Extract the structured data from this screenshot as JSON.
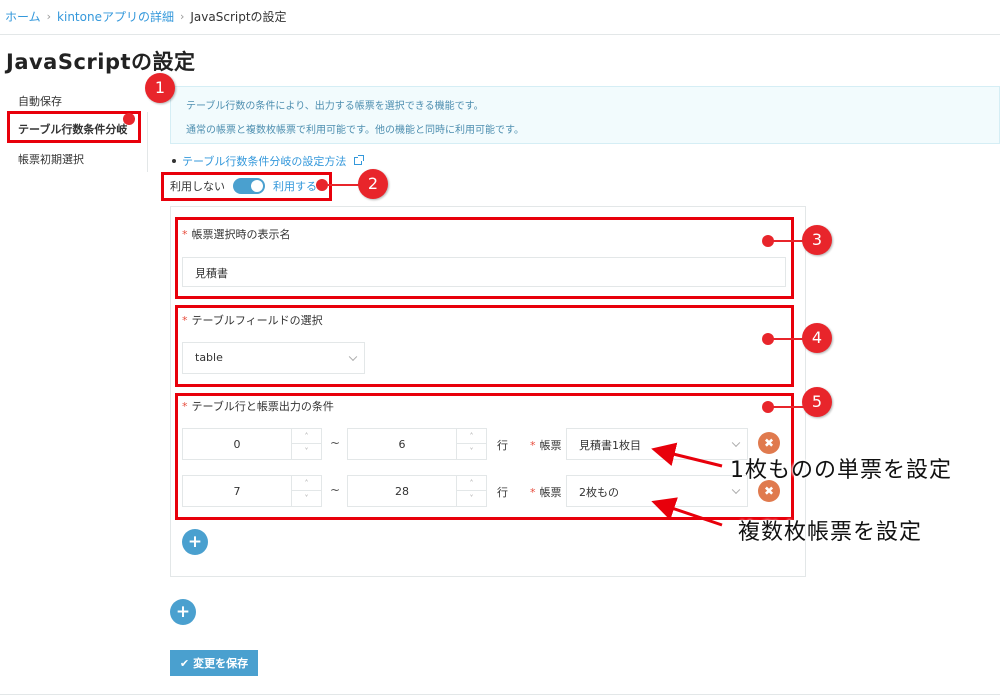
{
  "breadcrumb": {
    "home": "ホーム",
    "app": "kintoneアプリの詳細",
    "current": "JavaScriptの設定"
  },
  "page_title": "JavaScriptの設定",
  "side_nav": {
    "items": [
      {
        "label": "自動保存"
      },
      {
        "label": "テーブル行数条件分岐"
      },
      {
        "label": "帳票初期選択"
      }
    ],
    "active_index": 1
  },
  "info": {
    "line1": "テーブル行数の条件により、出力する帳票を選択できる機能です。",
    "line2": "通常の帳票と複数枚帳票で利用可能です。他の機能と同時に利用可能です。"
  },
  "help_link": "テーブル行数条件分岐の設定方法",
  "toggle": {
    "off_label": "利用しない",
    "on_label": "利用する",
    "state": "on"
  },
  "form": {
    "display_name_label": "帳票選択時の表示名",
    "display_name_value": "見積書",
    "table_field_label": "テーブルフィールドの選択",
    "table_field_value": "table",
    "conditions_label": "テーブル行と帳票出力の条件",
    "row_unit": "行",
    "form_label": "帳票",
    "tilde": "~",
    "rows": [
      {
        "from": "0",
        "to": "6",
        "form": "見積書1枚目"
      },
      {
        "from": "7",
        "to": "28",
        "form": "2枚もの"
      }
    ]
  },
  "save_button": "変更を保存",
  "annotations": {
    "callouts": [
      "1",
      "2",
      "3",
      "4",
      "5"
    ],
    "note_single": "1枚ものの単票を設定",
    "note_multi": "複数枚帳票を設定"
  },
  "colors": {
    "accent": "#4aa0cf",
    "link": "#3498db",
    "annotation_red": "#e8000b",
    "remove": "#e07a4e"
  }
}
